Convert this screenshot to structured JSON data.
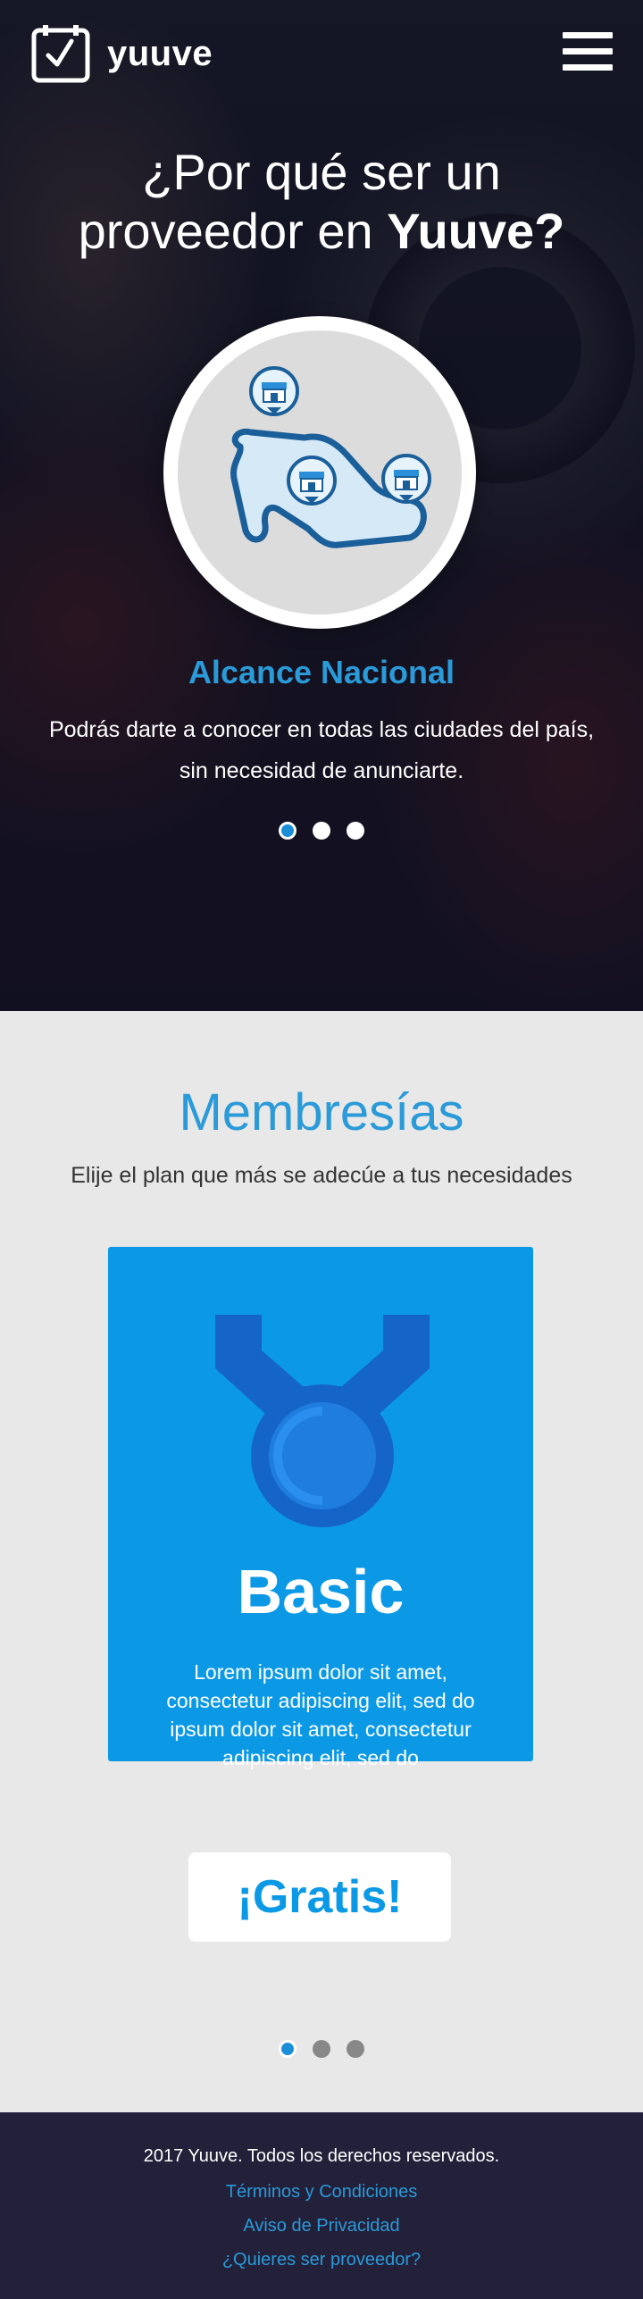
{
  "header": {
    "brand": "yuuve",
    "logo_icon": "calendar-check-icon",
    "menu_icon": "hamburger-menu-icon"
  },
  "hero": {
    "title_line1": "¿Por qué ser un",
    "title_line2_plain": "proveedor en",
    "title_line2_bold": "Yuuve?",
    "feature_icon": "map-store-pins-icon",
    "feature_title": "Alcance Nacional",
    "feature_desc": "Podrás darte a conocer en todas las ciudades del país, sin necesidad de anunciarte.",
    "carousel_count": 3,
    "carousel_active": 0
  },
  "memberships": {
    "title": "Membresías",
    "subtitle": "Elije el plan que más se adecúe a tus necesidades",
    "plan": {
      "icon": "medal-icon",
      "name": "Basic",
      "description": "Lorem ipsum dolor sit amet, consectetur adipiscing elit, sed do ipsum  dolor sit amet, consectetur adipiscing  elit, sed do",
      "button": "¡Gratis!"
    },
    "carousel_count": 3,
    "carousel_active": 0
  },
  "footer": {
    "copyright": "2017 Yuuve.  Todos los derechos reservados.",
    "links": [
      "Términos y Condiciones",
      "Aviso de Privacidad",
      "¿Quieres ser proveedor?"
    ]
  },
  "colors": {
    "accent": "#2a9ad8",
    "card_blue": "#0b99e6",
    "footer_bg": "#23203a"
  }
}
